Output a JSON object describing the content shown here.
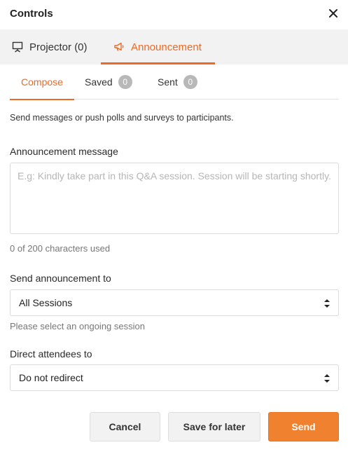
{
  "header": {
    "title": "Controls",
    "close_icon": "close-icon"
  },
  "main_tabs": [
    {
      "label": "Projector (0)",
      "icon": "projector-icon",
      "active": false
    },
    {
      "label": "Announcement",
      "icon": "megaphone-icon",
      "active": true
    }
  ],
  "sub_tabs": [
    {
      "label": "Compose",
      "active": true
    },
    {
      "label": "Saved",
      "count": "0",
      "active": false
    },
    {
      "label": "Sent",
      "count": "0",
      "active": false
    }
  ],
  "description": "Send messages or push polls and surveys to participants.",
  "message": {
    "label": "Announcement message",
    "value": "",
    "placeholder": "E.g: Kindly take part in this Q&A session. Session will be starting shortly.",
    "char_count": "0 of 200 characters used"
  },
  "send_to": {
    "label": "Send announcement to",
    "selected": "All Sessions",
    "hint": "Please select an ongoing session"
  },
  "direct": {
    "label": "Direct attendees to",
    "selected": "Do not redirect"
  },
  "buttons": {
    "cancel": "Cancel",
    "save_later": "Save for later",
    "send": "Send"
  },
  "colors": {
    "accent": "#ee6a24",
    "send_button": "#f0812f",
    "badge": "#b8b8b8",
    "tab_bar": "#f2f2f2"
  }
}
